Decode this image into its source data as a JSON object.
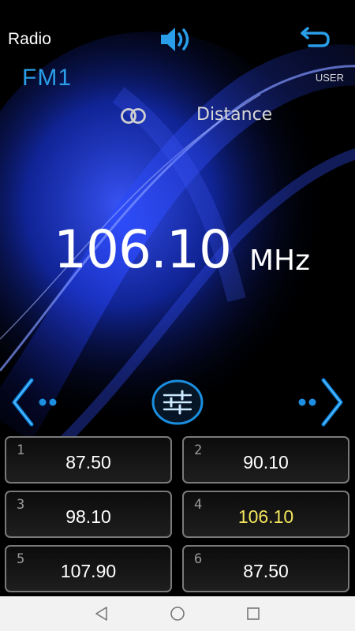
{
  "header": {
    "title": "Radio",
    "band": "FM1",
    "user_mode": "USER",
    "distance_label": "Distance",
    "volume_icon": "speaker-volume-icon",
    "back_icon": "back-arrow-icon",
    "stereo_icon": "stereo-rings-icon"
  },
  "tuner": {
    "frequency": "106.10",
    "unit": "MHz"
  },
  "controls": {
    "prev_icon": "chevron-left-icon",
    "next_icon": "chevron-right-icon",
    "eq_icon": "equalizer-sliders-icon"
  },
  "presets": [
    {
      "num": "1",
      "freq": "87.50"
    },
    {
      "num": "2",
      "freq": "90.10"
    },
    {
      "num": "3",
      "freq": "98.10"
    },
    {
      "num": "4",
      "freq": "106.10",
      "active": true
    },
    {
      "num": "5",
      "freq": "107.90"
    },
    {
      "num": "6",
      "freq": "87.50"
    }
  ],
  "navbar": {
    "back_icon": "nav-back-triangle-icon",
    "home_icon": "nav-home-circle-icon",
    "recents_icon": "nav-recents-square-icon"
  },
  "colors": {
    "accent_blue": "#2a9ee8",
    "active_preset": "#f2e55c",
    "background": "#000000"
  }
}
